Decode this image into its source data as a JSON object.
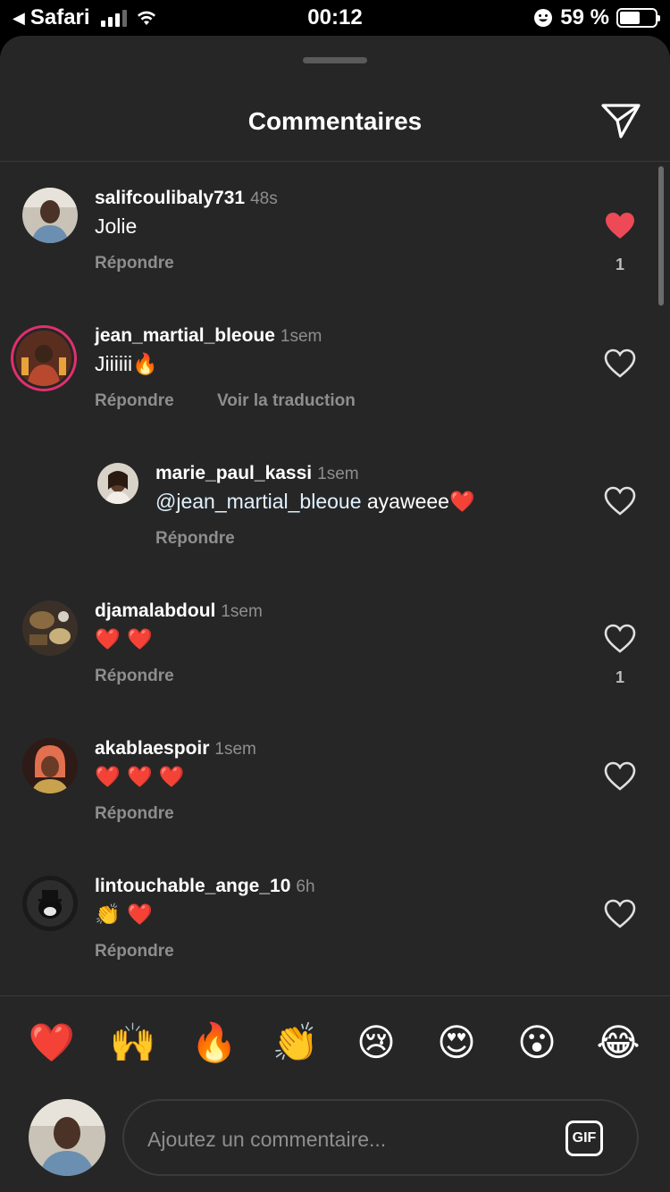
{
  "status_bar": {
    "back_label": "Safari",
    "time": "00:12",
    "battery": "59 %",
    "battery_level": 0.59
  },
  "sheet": {
    "title": "Commentaires"
  },
  "comments": [
    {
      "username": "salifcoulibaly731",
      "time": "48s",
      "text": "Jolie",
      "reply_label": "Répondre",
      "liked": true,
      "like_count": "1"
    },
    {
      "username": "jean_martial_bleoue",
      "time": "1sem",
      "text": "Jiiiiii",
      "text_emoji": "🔥",
      "reply_label": "Répondre",
      "translate_label": "Voir la traduction",
      "liked": false
    },
    {
      "username": "marie_paul_kassi",
      "time": "1sem",
      "mention": "@jean_martial_bleoue",
      "text": "ayaweee",
      "text_emoji": "❤️",
      "reply_label": "Répondre",
      "liked": false
    },
    {
      "username": "djamalabdoul",
      "time": "1sem",
      "text_emoji": "❤️ ❤️",
      "reply_label": "Répondre",
      "liked": false,
      "like_count": "1"
    },
    {
      "username": "akablaespoir",
      "time": "1sem",
      "text_emoji": "❤️ ❤️ ❤️",
      "reply_label": "Répondre",
      "liked": false
    },
    {
      "username": "lintouchable_ange_10",
      "time": "6h",
      "text_emoji": "👏 ❤️",
      "reply_label": "Répondre",
      "liked": false
    }
  ],
  "emoji_bar": [
    "❤️",
    "🙌",
    "🔥",
    "👏",
    "😢",
    "😍",
    "😮",
    "😂"
  ],
  "composer": {
    "placeholder": "Ajoutez un commentaire...",
    "gif_label": "GIF"
  },
  "colors": {
    "sheet_bg": "#262626",
    "like_red": "#ed4956",
    "secondary_text": "#8e8e8e"
  }
}
